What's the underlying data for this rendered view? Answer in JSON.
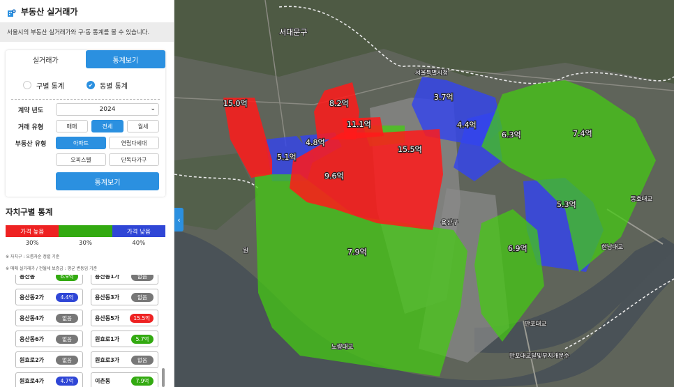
{
  "app": {
    "title": "부동산 실거래가",
    "description": "서울시의 부동산 실거래가와 구·동 통계를 볼 수 있습니다.",
    "logo_icon": "building-location-icon"
  },
  "tabs": [
    {
      "label": "실거래가",
      "active": false
    },
    {
      "label": "통계보기",
      "active": true
    }
  ],
  "stat_type": {
    "options": [
      "구별 통계",
      "동별 통계"
    ],
    "selected": "동별 통계"
  },
  "filters": {
    "year_label": "계약 년도",
    "year_value": "2024",
    "trade_label": "거래 유형",
    "trade_options": [
      "매매",
      "전세",
      "월세"
    ],
    "trade_selected": "전세",
    "property_label": "부동산 유형",
    "property_options": [
      "아파트",
      "연립다세대",
      "오피스텔",
      "단독다가구"
    ],
    "property_selected": "아파트",
    "submit_label": "통계보기"
  },
  "district_stats": {
    "title": "자치구별 통계",
    "legend": [
      {
        "label": "가격 높음",
        "color": "#ee2222",
        "pct": "30%"
      },
      {
        "label": "",
        "color": "#33aa11",
        "pct": "30%"
      },
      {
        "label": "가격 낮음",
        "color": "#2f46d6",
        "pct": "40%"
      }
    ],
    "notes": [
      "※ 자치구 : 오름차순 정렬 기준",
      "※ 매매 실거래가 / 전월세 보증금 : 평균 변동임 기준"
    ]
  },
  "dong_list": [
    {
      "name": "용산동",
      "value": "6.9억",
      "color": "green"
    },
    {
      "name": "용산동1가",
      "value": "없음",
      "color": "none"
    },
    {
      "name": "용산동2가",
      "value": "4.4억",
      "color": "blue"
    },
    {
      "name": "용산동3가",
      "value": "없음",
      "color": "none"
    },
    {
      "name": "용산동4가",
      "value": "없음",
      "color": "none"
    },
    {
      "name": "용산동5가",
      "value": "15.5억",
      "color": "red"
    },
    {
      "name": "용산동6가",
      "value": "없음",
      "color": "none"
    },
    {
      "name": "원효로1가",
      "value": "5.7억",
      "color": "green"
    },
    {
      "name": "원효로2가",
      "value": "없음",
      "color": "none"
    },
    {
      "name": "원효로3가",
      "value": "없음",
      "color": "none"
    },
    {
      "name": "원효로4가",
      "value": "4.7억",
      "color": "blue"
    },
    {
      "name": "이촌동",
      "value": "7.9억",
      "color": "green"
    }
  ],
  "map": {
    "collapse_icon": "chevron-left-icon",
    "place_labels": [
      "서울특별시청",
      "서대문구",
      "용산구",
      "반포대교",
      "한남대교",
      "동호대교",
      "노량대교",
      "반포대교달빛무지개분수",
      "원"
    ],
    "extrusions": [
      {
        "label": "15.0억",
        "color": "red"
      },
      {
        "label": "8.2억",
        "color": "red"
      },
      {
        "label": "11.1억",
        "color": "red"
      },
      {
        "label": "15.5억",
        "color": "red"
      },
      {
        "label": "9.6억",
        "color": "red"
      },
      {
        "label": "3.7억",
        "color": "blue"
      },
      {
        "label": "4.4억",
        "color": "blue"
      },
      {
        "label": "5.1억",
        "color": "blue"
      },
      {
        "label": "4.8억",
        "color": "blue"
      },
      {
        "label": "5.3억",
        "color": "blue"
      },
      {
        "label": "6.3억",
        "color": "green"
      },
      {
        "label": "7.4억",
        "color": "green"
      },
      {
        "label": "7.9억",
        "color": "green"
      },
      {
        "label": "6.9억",
        "color": "green"
      }
    ]
  }
}
